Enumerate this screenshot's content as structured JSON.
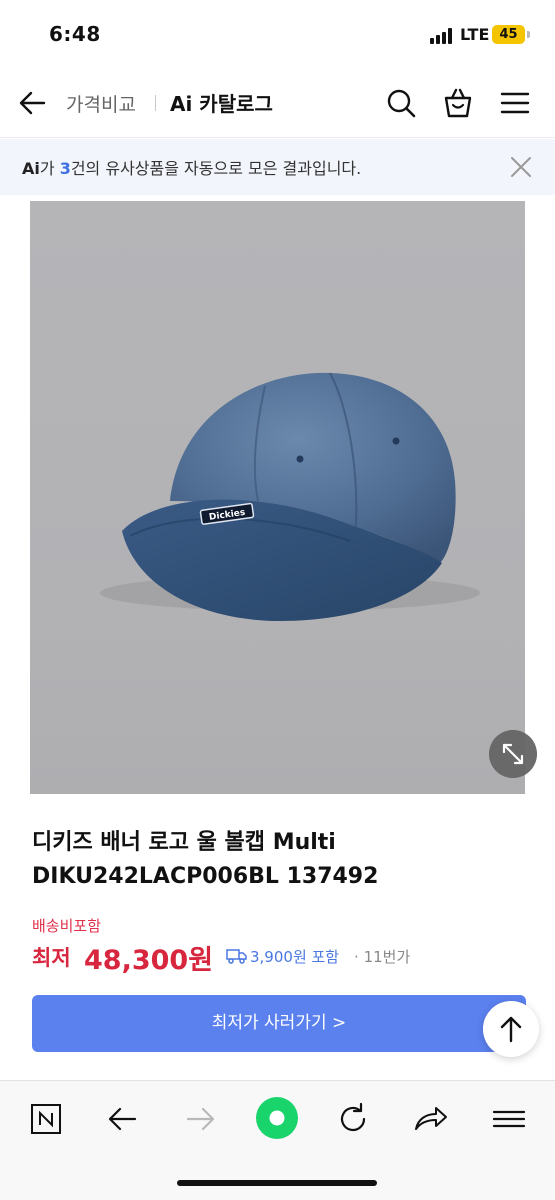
{
  "status_bar": {
    "time": "6:48",
    "network": "LTE",
    "battery": "45"
  },
  "header": {
    "breadcrumb_1": "가격비교",
    "breadcrumb_2": "Ai 카탈로그",
    "icons": [
      "back-arrow-icon",
      "search-icon",
      "shopping-bag-icon",
      "menu-icon"
    ]
  },
  "ai_banner": {
    "ai_mark": "Ai",
    "prefix": "가 ",
    "count": "3",
    "suffix": "건의 유사상품을 자동으로 모은 결과입니다."
  },
  "product": {
    "title": "디키즈 배너 로고 울 볼캡 Multi DIKU242LACP006BL 137492",
    "shipping_label": "배송비포함",
    "price_prefix": "최저",
    "price": "48,300원",
    "shipping_fee": "3,900원 포함",
    "separator": "·",
    "seller": "11번가",
    "cap_logo": "Dickies"
  },
  "actions": {
    "buy_label": "최저가 사러가기 >"
  },
  "toolbar": {
    "items": [
      "n-logo-icon",
      "back-icon",
      "forward-icon",
      "green-dot-icon",
      "refresh-icon",
      "share-icon",
      "menu-icon"
    ]
  },
  "colors": {
    "accent_blue": "#5b81ef",
    "price_red": "#d7263d",
    "banner_bg": "#f2f5fb",
    "battery_yellow": "#f5c400",
    "toolbar_green": "#19d36b"
  }
}
